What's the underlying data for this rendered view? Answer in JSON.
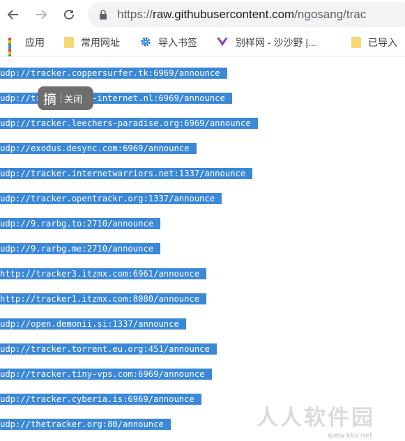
{
  "toolbar": {
    "url_scheme": "https://",
    "url_host": "raw.githubusercontent.com",
    "url_path": "/ngosang/trac"
  },
  "bookmarks": {
    "items": [
      {
        "label": "应用",
        "icon": "apps-grid-icon"
      },
      {
        "label": "常用网址",
        "icon": "folder-icon"
      },
      {
        "label": "导入书签",
        "icon": "gear-icon"
      },
      {
        "label": "别样网 - 沙沙野 |...",
        "icon": "site-logo-icon"
      },
      {
        "label": "已导入",
        "icon": "folder-icon"
      }
    ]
  },
  "trackers": [
    "udp://tracker.coppersurfer.tk:6969/announce",
    "udp://tracker.open-internet.nl:6969/announce",
    "udp://tracker.leechers-paradise.org:6969/announce",
    "udp://exodus.desync.com:6969/announce",
    "udp://tracker.internetwarriors.net:1337/announce",
    "udp://tracker.opentrackr.org:1337/announce",
    "udp://9.rarbg.to:2710/announce",
    "udp://9.rarbg.me:2710/announce",
    "http://tracker3.itzmx.com:6961/announce",
    "http://tracker1.itzmx.com:8080/announce",
    "udp://open.demonii.si:1337/announce",
    "udp://tracker.torrent.eu.org:451/announce",
    "udp://tracker.tiny-vps.com:6969/announce",
    "udp://tracker.cyberia.is:6969/announce",
    "udp://thetracker.org:80/announce"
  ],
  "pill": {
    "icon_char": "摘",
    "close_label": "关闭"
  },
  "watermark": {
    "text": "人人软件园",
    "url": "www.kkx.net"
  },
  "colors": {
    "selection": "#3b88d8",
    "omnibox_bg": "#f1f3f4",
    "folder": "#f8d775"
  }
}
